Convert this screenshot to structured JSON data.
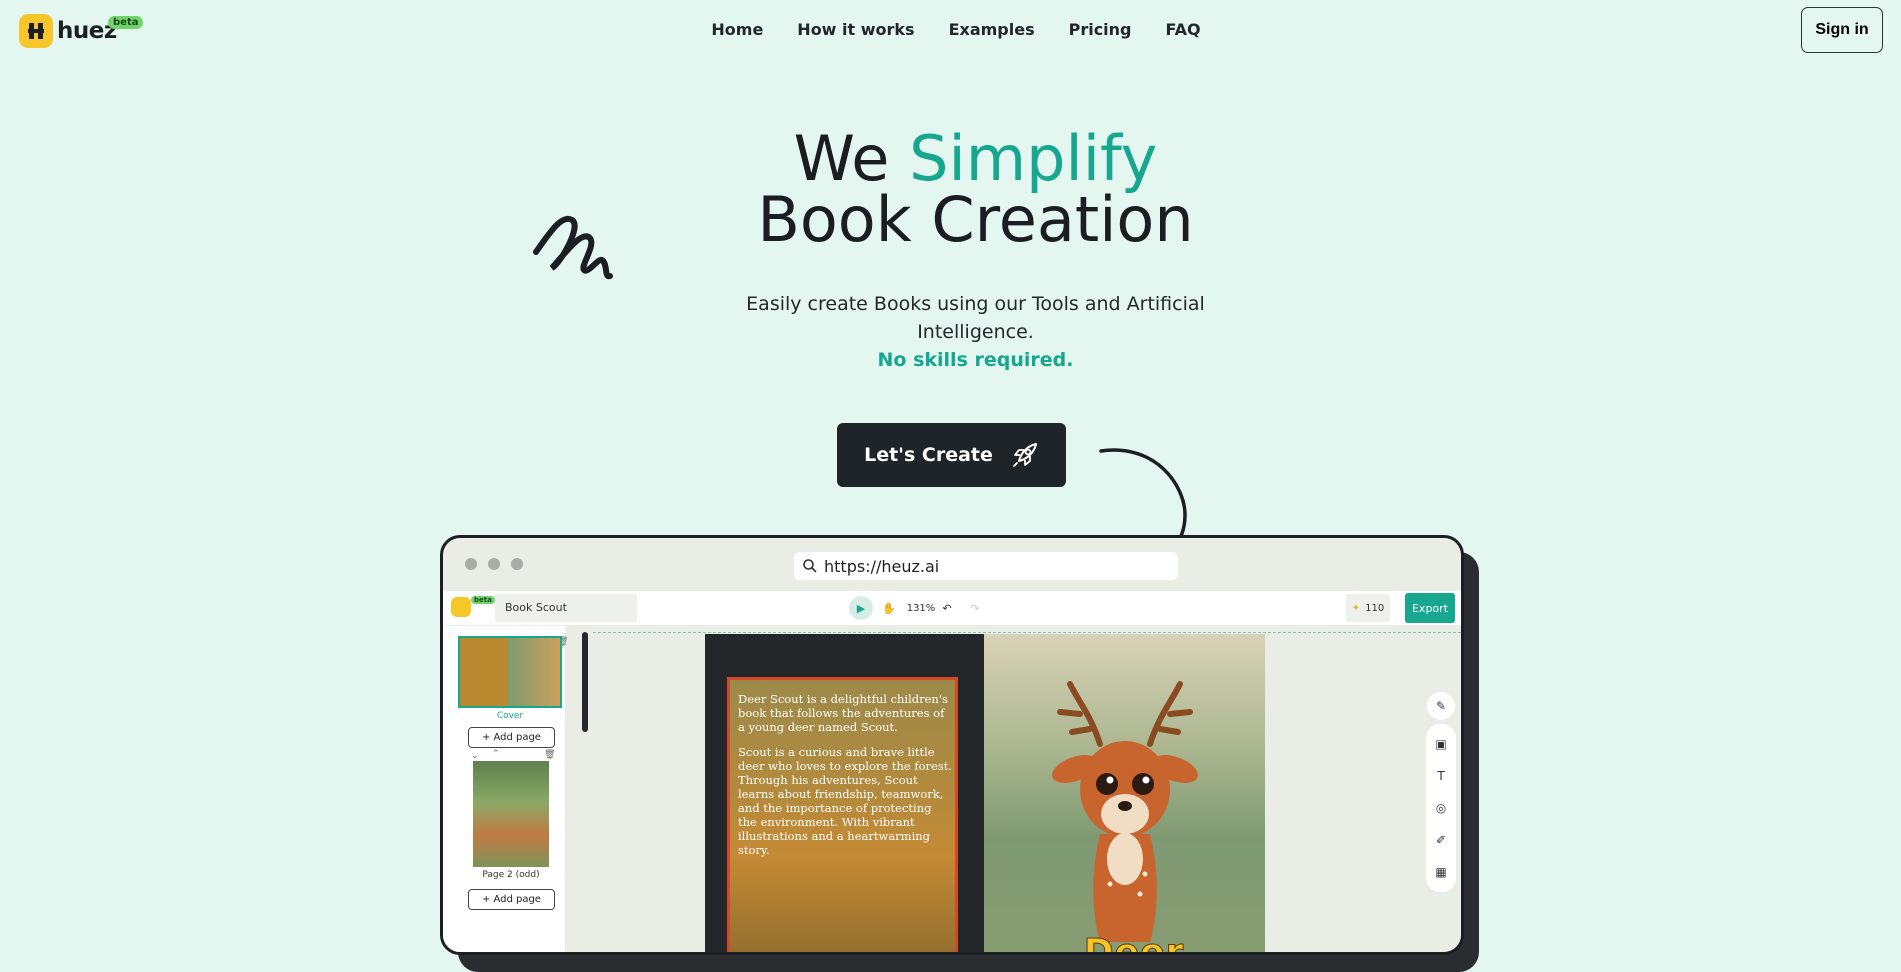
{
  "brand": {
    "name": "huez",
    "badge": "beta"
  },
  "nav": [
    "Home",
    "How it works",
    "Examples",
    "Pricing",
    "FAQ"
  ],
  "signin_label": "Sign in",
  "hero": {
    "title_part1": "We ",
    "title_accent": "Simplify",
    "title_line2": "Book Creation",
    "subtitle_line1": "Easily create Books using our Tools and Artificial",
    "subtitle_line2": "Intelligence.",
    "subtitle_highlight": "No skills required.",
    "cta_label": "Let's Create"
  },
  "mock": {
    "url": "https://heuz.ai",
    "app_badge": "beta",
    "book_name": "Book Scout",
    "zoom": "131%",
    "credits": "110",
    "export_label": "Export",
    "cover_label": "Cover",
    "add_page_label": "Add page",
    "page2_label": "Page 2 (odd)",
    "page_text_p1": "Deer Scout is a delightful children's book that follows the adventures of a young deer named Scout.",
    "page_text_p2": "Scout is a curious and brave little deer who loves to explore the forest. Through his adventures, Scout learns about friendship, teamwork, and the importance of protecting the environment. With vibrant illustrations and a heartwarming story.",
    "cover_title": "Deer Scout"
  },
  "colors": {
    "accent": "#17a68e",
    "background": "#e3f6ef",
    "dark": "#1f2428",
    "logo": "#f7c72a"
  }
}
